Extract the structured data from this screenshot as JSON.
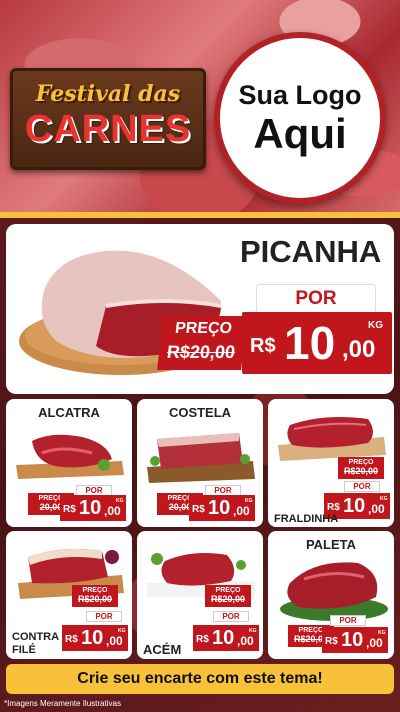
{
  "hero": {
    "title_line1": "Festival das",
    "title_line2": "CARNES",
    "logo_line1": "Sua Logo",
    "logo_line2": "Aqui"
  },
  "featured": {
    "name": "PICANHA",
    "por_label": "POR",
    "preco_label": "PREÇO",
    "old_price": "R$20,00",
    "currency": "R$",
    "price_int": "10",
    "price_cents": ",00",
    "unit": "KG"
  },
  "products": [
    {
      "name": "ALCATRA",
      "preco_label": "PREÇO",
      "old_price": "20,00",
      "por_label": "POR",
      "currency": "R$",
      "price_int": "10",
      "price_cents": ",00",
      "unit": "KG"
    },
    {
      "name": "COSTELA",
      "preco_label": "PREÇO",
      "old_price": "20,00",
      "por_label": "POR",
      "currency": "R$",
      "price_int": "10",
      "price_cents": ",00",
      "unit": "KG"
    },
    {
      "name": "FRALDINHA",
      "preco_label": "PREÇO",
      "old_price": "R$20,00",
      "por_label": "POR",
      "currency": "R$",
      "price_int": "10",
      "price_cents": ",00",
      "unit": "KG"
    },
    {
      "name_line1": "CONTRA",
      "name_line2": "FILÉ",
      "preco_label": "PREÇO",
      "old_price": "R$20,00",
      "por_label": "POR",
      "currency": "R$",
      "price_int": "10",
      "price_cents": ",00",
      "unit": "KG"
    },
    {
      "name": "ACÉM",
      "preco_label": "PREÇO",
      "old_price": "R$20,00",
      "por_label": "POR",
      "currency": "R$",
      "price_int": "10",
      "price_cents": ",00",
      "unit": "KG"
    },
    {
      "name": "PALETA",
      "preco_label": "PREÇO",
      "old_price": "R$20,00",
      "por_label": "POR",
      "currency": "R$",
      "price_int": "10",
      "price_cents": ",00",
      "unit": "KG"
    }
  ],
  "cta": "Crie seu encarte com este tema!",
  "disclaimer": "*Imagens Meramente Ilustrativas",
  "colors": {
    "accent_red": "#c1161b",
    "gold": "#f7c23a",
    "board_brown": "#4a2612"
  }
}
